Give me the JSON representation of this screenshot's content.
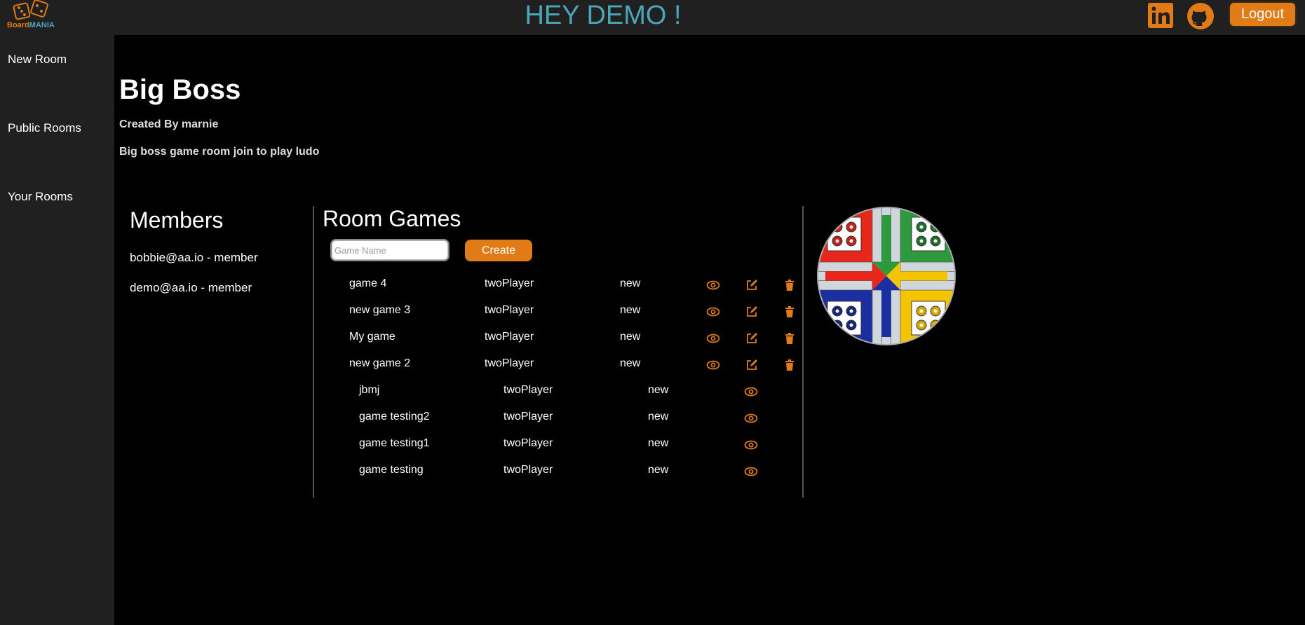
{
  "header": {
    "logo_part1": "Board",
    "logo_part2": "MANIA",
    "greeting": "HEY DEMO !",
    "logout_label": "Logout",
    "icons": [
      "linkedin-icon",
      "github-icon"
    ]
  },
  "sidebar": {
    "items": [
      {
        "label": "New Room"
      },
      {
        "label": "Public Rooms"
      },
      {
        "label": "Your Rooms"
      }
    ]
  },
  "room": {
    "title": "Big Boss",
    "created_by": "Created By marnie",
    "description": "Big boss game room join to play ludo"
  },
  "members": {
    "title": "Members",
    "items": [
      "bobbie@aa.io - member",
      "demo@aa.io - member"
    ]
  },
  "games": {
    "title": "Room Games",
    "input_placeholder": "Game Name",
    "create_label": "Create",
    "owned": [
      {
        "name": "game 4",
        "type": "twoPlayer",
        "status": "new"
      },
      {
        "name": "new game 3",
        "type": "twoPlayer",
        "status": "new"
      },
      {
        "name": "My game",
        "type": "twoPlayer",
        "status": "new"
      },
      {
        "name": "new game 2",
        "type": "twoPlayer",
        "status": "new"
      }
    ],
    "others": [
      {
        "name": "jbmj",
        "type": "twoPlayer",
        "status": "new"
      },
      {
        "name": "game testing2",
        "type": "twoPlayer",
        "status": "new"
      },
      {
        "name": "game testing1",
        "type": "twoPlayer",
        "status": "new"
      },
      {
        "name": "game testing",
        "type": "twoPlayer",
        "status": "new"
      }
    ]
  },
  "colors": {
    "accent": "#e07b16",
    "greeting": "#4aa6b8",
    "sidebar_bg": "#202020",
    "ludo": [
      "#e8261c",
      "#2e9a3e",
      "#1c2fa0",
      "#f5c400"
    ]
  }
}
